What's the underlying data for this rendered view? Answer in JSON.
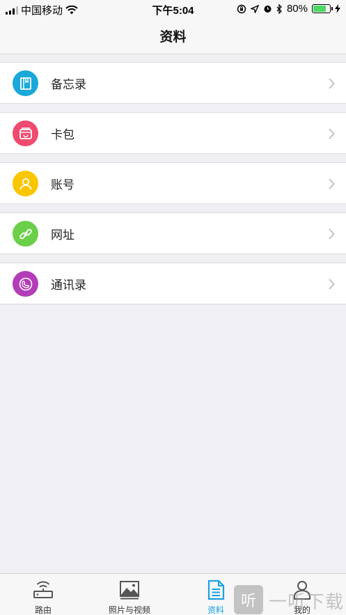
{
  "status_bar": {
    "carrier": "中国移动",
    "time": "下午5:04",
    "battery_percent": "80%",
    "battery_level": 0.8,
    "icons": [
      "signal-icon",
      "wifi-icon",
      "orientation-lock-icon",
      "location-icon",
      "alarm-icon",
      "bluetooth-icon",
      "battery-icon",
      "charging-icon"
    ]
  },
  "nav": {
    "title": "资料"
  },
  "list": {
    "items": [
      {
        "label": "备忘录",
        "icon": "notebook-icon",
        "color": "#1aa8d8"
      },
      {
        "label": "卡包",
        "icon": "wallet-icon",
        "color": "#ef4b6e"
      },
      {
        "label": "账号",
        "icon": "user-icon",
        "color": "#f9c600"
      },
      {
        "label": "网址",
        "icon": "link-icon",
        "color": "#6ccf4a"
      },
      {
        "label": "通讯录",
        "icon": "phone-icon",
        "color": "#b33cb8"
      }
    ]
  },
  "tabbar": {
    "tabs": [
      {
        "label": "路由",
        "icon": "router-icon"
      },
      {
        "label": "照片与视频",
        "icon": "photo-icon"
      },
      {
        "label": "资料",
        "icon": "document-icon",
        "active": true
      },
      {
        "label": "我的",
        "icon": "profile-icon"
      }
    ],
    "active_color": "#1aa1e0"
  },
  "watermark": {
    "badge": "听",
    "text": "一听下载"
  }
}
